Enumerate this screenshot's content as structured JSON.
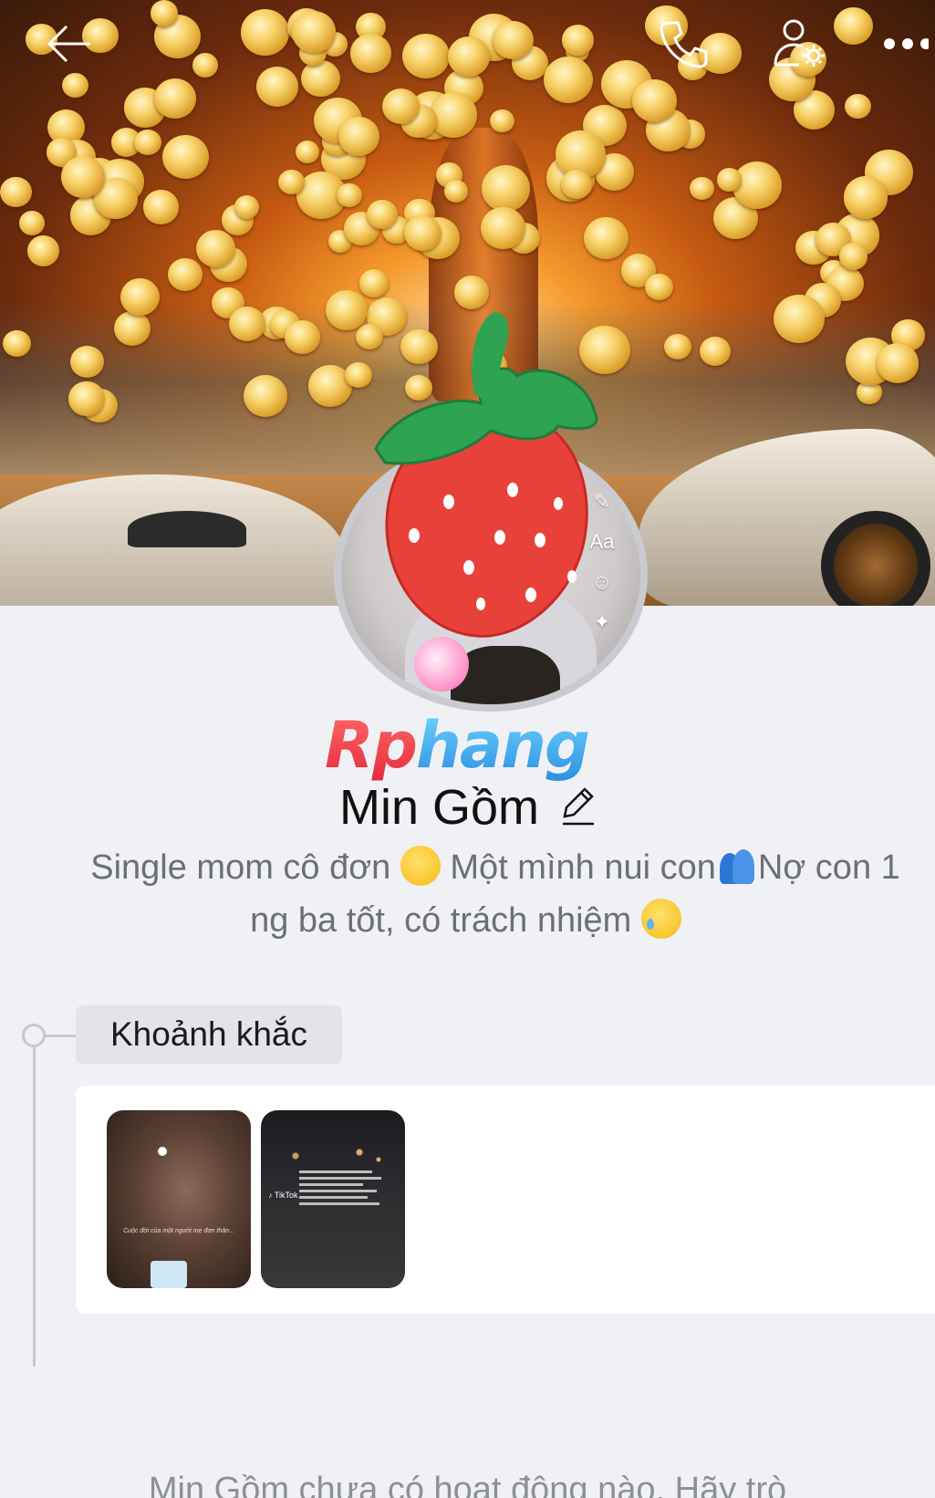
{
  "cover": {
    "description_icon": "cover-photo"
  },
  "topbar": {
    "back_icon": "arrow-left-icon",
    "call_icon": "phone-icon",
    "settings_icon": "user-settings-icon",
    "more_icon": "more-dots-icon"
  },
  "avatar": {
    "side_icon_text": "Aa"
  },
  "watermark": {
    "part_a": "Rp",
    "part_b": "hang"
  },
  "profile": {
    "name": "Min Gồm",
    "bio_line1_a": "Single mom cô đơn ",
    "bio_line1_b": " Một mình nui con",
    "bio_line1_c": "Nợ con 1",
    "bio_line2_a": "ng ba tốt, có trách nhiệm "
  },
  "moments": {
    "label": "Khoảnh khắc",
    "thumb1_caption": "Cuộc đời của một người mẹ đơn thân...",
    "thumb2_brand": "♪ TikTok"
  },
  "footer": {
    "message": "Min Gồm chưa có hoạt động nào. Hãy trò"
  },
  "colors": {
    "page_bg": "#f0f1f5",
    "card_bg": "#ffffff",
    "chip_bg": "#e2e4e9",
    "muted_text": "#6c6f78"
  }
}
